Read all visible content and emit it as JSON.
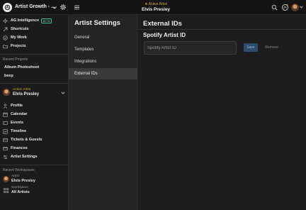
{
  "app": {
    "title": "Artist Growth - ...",
    "accent": "#d4a441"
  },
  "header": {
    "active_kicker": "Active Artist",
    "active_star": "★",
    "active_name": "Elvis Presley"
  },
  "sidebar": {
    "items": [
      {
        "label": "AG Intelligence",
        "icon": "sparkle-icon",
        "badge": "BETA"
      },
      {
        "label": "Shortcuts",
        "icon": "shortcut-icon"
      },
      {
        "label": "My Work",
        "icon": "check-circle-icon"
      },
      {
        "label": "Projects",
        "icon": "folder-icon"
      }
    ],
    "recent_projects_label": "Recent Projects",
    "recent_projects": [
      "Album Photoshoot",
      "beep"
    ],
    "artist_kicker": "Active Artist",
    "artist_name": "Elvis Presley",
    "artist_items": [
      {
        "label": "Profile",
        "icon": "person-icon"
      },
      {
        "label": "Calendar",
        "icon": "calendar-icon"
      },
      {
        "label": "Events",
        "icon": "ticket-icon"
      },
      {
        "label": "Timeline",
        "icon": "timeline-icon"
      },
      {
        "label": "Tickets & Guests",
        "icon": "guests-icon"
      },
      {
        "label": "Finances",
        "icon": "finances-icon"
      },
      {
        "label": "Artist Settings",
        "icon": "settings-icon"
      }
    ],
    "recent_workspaces_label": "Recent Workspaces",
    "workspaces": [
      {
        "kicker": "Artist",
        "name": "Elvis Presley",
        "icon": "artist-avatar-icon"
      },
      {
        "kicker": "Workspace",
        "name": "All Artists",
        "icon": "workspace-grid-icon"
      }
    ]
  },
  "settings_nav": {
    "title": "Artist Settings",
    "items": [
      "General",
      "Templates",
      "Integrations",
      "External IDs"
    ],
    "active": "External IDs"
  },
  "main": {
    "title": "External IDs",
    "section_title": "Spotify Artist ID",
    "input_value": "",
    "input_placeholder": "Spotify Artist ID",
    "save_label": "Save",
    "remove_label": "Remove"
  }
}
